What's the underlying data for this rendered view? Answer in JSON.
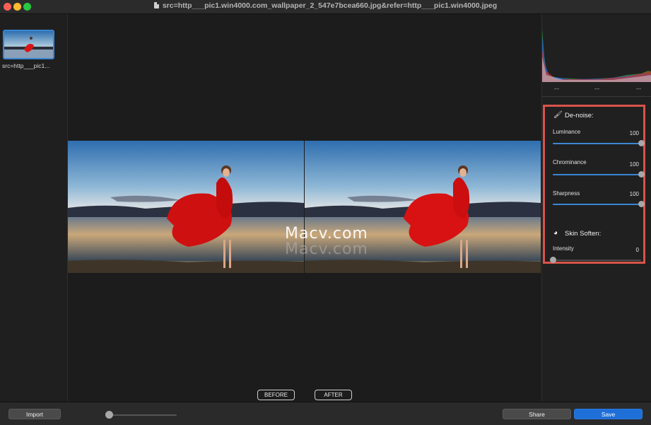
{
  "window": {
    "title": "src=http___pic1.win4000.com_wallpaper_2_547e7bcea660.jpg&refer=http___pic1.win4000.jpeg"
  },
  "sidebar": {
    "thumbnails": [
      {
        "label": "src=http___pic1..."
      }
    ]
  },
  "canvas": {
    "watermark": "Macv.com",
    "watermark_echo": "Macv.com",
    "before_label": "BEFORE",
    "after_label": "AFTER"
  },
  "histogram": {
    "stats": [
      "---",
      "---",
      "---"
    ]
  },
  "adjustments": {
    "denoise": {
      "title": "De-noise:",
      "icon": "brush-icon",
      "luminance": {
        "label": "Luminance",
        "value": 100,
        "max": 100
      },
      "chrominance": {
        "label": "Chrominance",
        "value": 100,
        "max": 100
      },
      "sharpness": {
        "label": "Sharpness",
        "value": 100,
        "max": 100
      }
    },
    "skin_soften": {
      "title": "Skin Soften:",
      "icon": "face-icon",
      "intensity": {
        "label": "Intensity",
        "value": 0,
        "max": 100
      }
    }
  },
  "bottombar": {
    "import_label": "Import",
    "share_label": "Share",
    "save_label": "Save",
    "zoom_level": 0
  },
  "colors": {
    "accent": "#1e6fd8",
    "highlight_border": "#d9534a",
    "selection": "#3a86d4"
  }
}
